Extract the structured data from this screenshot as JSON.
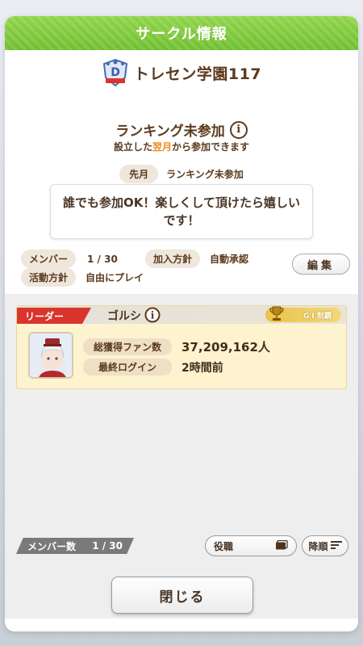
{
  "dialog": {
    "title": "サークル情報"
  },
  "circle": {
    "name": "トレセン学園117"
  },
  "ranking": {
    "title": "ランキング未参加",
    "sub_prefix": "設立した",
    "sub_highlight": "翌月",
    "sub_suffix": "から参加できます",
    "last_month_label": "先月",
    "last_month_value": "ランキング未参加"
  },
  "message": "誰でも参加OK！楽しくして頂けたら嬉しいです！",
  "info": {
    "members_label": "メンバー",
    "members_value": "1 / 30",
    "join_label": "加入方針",
    "join_value": "自動承認",
    "activity_label": "活動方針",
    "activity_value": "自由にプレイ",
    "edit_label": "編集"
  },
  "leader": {
    "badge": "リーダー",
    "name": "ゴルシ",
    "g1_label": "G I 制覇",
    "fans_label": "総獲得ファン数",
    "fans_value": "37,209,162人",
    "login_label": "最終ログイン",
    "login_value": "2時間前"
  },
  "footer": {
    "member_count_label": "メンバー数",
    "member_count_value": "1 / 30",
    "role_label": "役職",
    "sort_label": "降順",
    "close_label": "閉じる"
  },
  "colors": {
    "header_green": "#7cc93a",
    "leader_red": "#d9352d",
    "highlight_orange": "#f08a1c",
    "card_yellow": "#fdf3cf"
  }
}
